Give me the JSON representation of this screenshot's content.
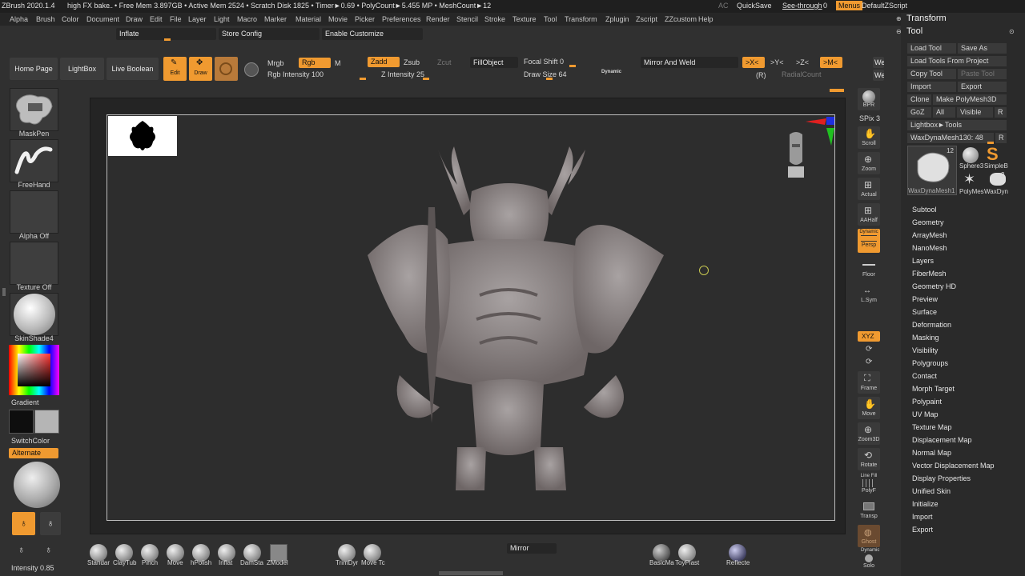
{
  "titlebar": {
    "app": "ZBrush 2020.1.4",
    "doc": "high FX bake",
    "dots": "..",
    "stats": "• Free Mem 3.897GB • Active Mem 2524 • Scratch Disk 1825 • Timer►0.69 • PolyCount►5.455 MP • MeshCount►12",
    "ac": "AC",
    "quicksave": "QuickSave",
    "seethrough": "See-through",
    "seethrough_value": "0",
    "menus": "Menus",
    "script": "DefaultZScript"
  },
  "menu": [
    "Alpha",
    "Brush",
    "Color",
    "Document",
    "Draw",
    "Edit",
    "File",
    "Layer",
    "Light",
    "Macro",
    "Marker",
    "Material",
    "Movie",
    "Picker",
    "Preferences",
    "Render",
    "Stencil",
    "Stroke",
    "Texture",
    "Tool",
    "Transform",
    "Zplugin",
    "Zscript",
    "ZZcustom",
    "Help"
  ],
  "topbar": {
    "inflate": "Inflate",
    "store_config": "Store Config",
    "enable_customize": "Enable Customize"
  },
  "shelf": {
    "home": "Home Page",
    "lightbox": "LightBox",
    "live_boolean": "Live Boolean",
    "edit": "Edit",
    "draw": "Draw",
    "mrgb": "Mrgb",
    "rgb": "Rgb",
    "m": "M",
    "rgb_intensity": "Rgb Intensity",
    "rgb_intensity_value": "100",
    "zadd": "Zadd",
    "zsub": "Zsub",
    "zcut": "Zcut",
    "z_intensity": "Z Intensity",
    "z_intensity_value": "25",
    "fillobject": "FillObject",
    "focal_shift": "Focal Shift",
    "focal_shift_value": "0",
    "draw_size": "Draw Size",
    "draw_size_value": "64",
    "dynamic": "Dynamic",
    "mirror_weld": "Mirror And Weld",
    "x": ">X<",
    "y": ">Y<",
    "z": ">Z<",
    "m2": ">M<",
    "r": "(R)",
    "radialcount": "RadialCount",
    "we1": "We",
    "we2": "We"
  },
  "left": {
    "maskpen": "MaskPen",
    "freehand": "FreeHand",
    "alpha": "Alpha Off",
    "texture": "Texture Off",
    "material": "SkinShade4",
    "gradient": "Gradient",
    "switchcolor": "SwitchColor",
    "alternate": "Alternate",
    "intensity": "Intensity",
    "intensity_value": "0.85"
  },
  "rightstrip": [
    "BPR",
    "SPix",
    "3",
    "Scroll",
    "Zoom",
    "Actual",
    "AAHalf",
    "Dynamic",
    "Persp",
    "Floor",
    "L.Sym",
    "XYZ",
    "Frame",
    "Move",
    "Zoom3D",
    "Rotate",
    "Line Fill",
    "PolyF",
    "Transp",
    "Ghost",
    "Dynamic",
    "Solo"
  ],
  "toolpanel": {
    "transform": "Transform",
    "tool": "Tool",
    "load_tool": "Load Tool",
    "save_as": "Save As",
    "load_from_project": "Load Tools From Project",
    "copy_tool": "Copy Tool",
    "paste_tool": "Paste Tool",
    "import": "Import",
    "export": "Export",
    "clone": "Clone",
    "make_polymesh": "Make PolyMesh3D",
    "goz": "GoZ",
    "all": "All",
    "visible": "Visible",
    "r": "R",
    "lightbox_tools": "Lightbox►Tools",
    "current": "WaxDynaMesh130:",
    "current_value": "48",
    "r2": "R",
    "thumb_count": "12",
    "thumb_count2": "2",
    "thumb1": "WaxDynaMesh1",
    "thumb2": "Sphere3",
    "thumb3": "SimpleB",
    "thumb4": "PolyMes",
    "thumb5": "WaxDyn",
    "subpalettes": [
      "Subtool",
      "Geometry",
      "ArrayMesh",
      "NanoMesh",
      "Layers",
      "FiberMesh",
      "Geometry HD",
      "Preview",
      "Surface",
      "Deformation",
      "Masking",
      "Visibility",
      "Polygroups",
      "Contact",
      "Morph Target",
      "Polypaint",
      "UV Map",
      "Texture Map",
      "Displacement Map",
      "Normal Map",
      "Vector Displacement Map",
      "Display Properties",
      "Unified Skin",
      "Initialize",
      "Import",
      "Export"
    ]
  },
  "bottom": {
    "brushes": [
      "Standar",
      "ClayTub",
      "Pinch",
      "Move",
      "hPolish",
      "Inflat",
      "DamSta",
      "ZModel"
    ],
    "trim": "TrimDyr",
    "movet": "Move Tc",
    "mirror": "Mirror",
    "basic": "BasicMa",
    "toyplast": "ToyPlast",
    "reflect": "Reflecte"
  },
  "colors": {
    "accent": "#f09a30",
    "bg": "#303030",
    "panel": "#2a2a2a"
  }
}
